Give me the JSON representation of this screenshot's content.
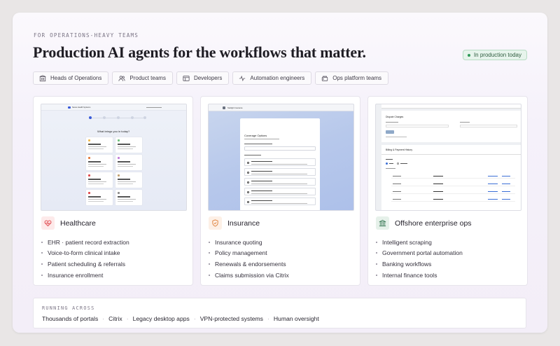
{
  "eyebrow": "FOR OPERATIONS-HEAVY TEAMS",
  "headline": "Production AI agents for the workflows that matter.",
  "badge": {
    "label": "In production today",
    "color": "#2f9a58"
  },
  "chips": [
    {
      "label": "Heads of Operations",
      "icon": "building-icon"
    },
    {
      "label": "Product teams",
      "icon": "users-icon"
    },
    {
      "label": "Developers",
      "icon": "window-icon"
    },
    {
      "label": "Automation engineers",
      "icon": "activity-icon"
    },
    {
      "label": "Ops platform teams",
      "icon": "server-icon"
    }
  ],
  "columns": [
    {
      "title": "Healthcare",
      "icon": "heart-pulse-icon",
      "accent": "#e0474c",
      "bullets": [
        "EHR · patient record extraction",
        "Voice-to-form clinical intake",
        "Patient scheduling & referrals",
        "Insurance enrollment"
      ]
    },
    {
      "title": "Insurance",
      "icon": "shield-icon",
      "accent": "#e0813a",
      "bullets": [
        "Insurance quoting",
        "Policy management",
        "Renewals & endorsements",
        "Claims submission via Citrix"
      ]
    },
    {
      "title": "Offshore enterprise ops",
      "icon": "bank-icon",
      "accent": "#3a7a57",
      "bullets": [
        "Intelligent scraping",
        "Government portal automation",
        "Banking workflows",
        "Internal finance tools"
      ]
    }
  ],
  "running": {
    "label": "RUNNING ACROSS",
    "items": [
      "Thousands of portals",
      "Citrix",
      "Legacy desktop apps",
      "VPN-protected systems",
      "Human oversight"
    ]
  },
  "screens": {
    "healthcare": {
      "org": "Nexus Health Systems",
      "prompt": "What brings you in today?"
    },
    "insurance": {
      "org": "Starlight Insurance",
      "heading": "Coverage Options"
    },
    "offshore": {
      "section1": "Dispute Charges",
      "section2": "Billing & Payment History"
    }
  }
}
